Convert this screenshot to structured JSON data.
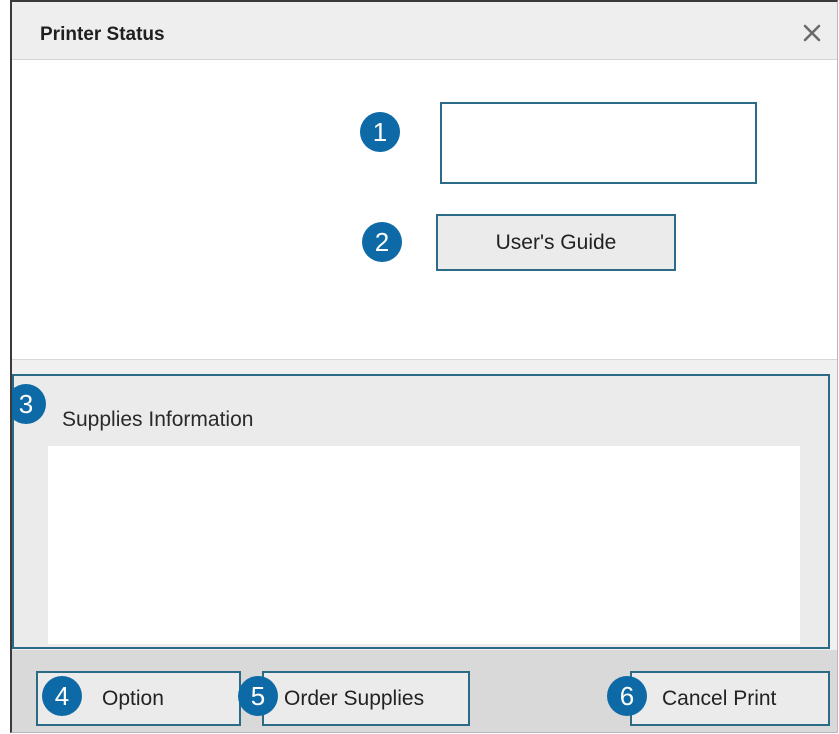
{
  "window": {
    "title": "Printer Status",
    "close_icon": "close-icon"
  },
  "callouts": [
    "1",
    "2",
    "3",
    "4",
    "5",
    "6"
  ],
  "status_display": {
    "value": ""
  },
  "buttons": {
    "users_guide": "User's Guide",
    "option": "Option",
    "order_supplies": "Order Supplies",
    "cancel_print": "Cancel Print"
  },
  "supplies": {
    "label": "Supplies Information",
    "content": ""
  },
  "colors": {
    "callout_badge": "#0d6aa6",
    "focus_border": "#2b6b87",
    "button_face": "#ebebeb"
  }
}
